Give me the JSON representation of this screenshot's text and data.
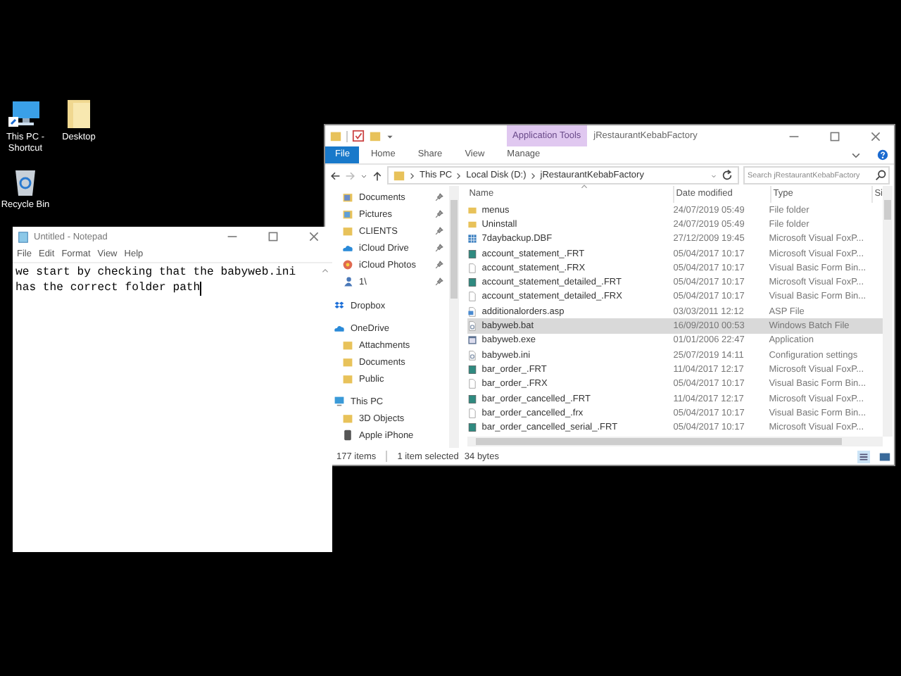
{
  "desktop_icons": [
    {
      "label": "This PC - Shortcut",
      "kind": "pc"
    },
    {
      "label": "Desktop",
      "kind": "folder"
    },
    {
      "label": "Recycle Bin",
      "kind": "bin"
    }
  ],
  "explorer": {
    "title": "jRestaurantKebabFactory",
    "context_label": "Application Tools",
    "tabs": [
      {
        "label": "File",
        "kind": "file"
      },
      {
        "label": "Home",
        "kind": "plain"
      },
      {
        "label": "Share",
        "kind": "plain"
      },
      {
        "label": "View",
        "kind": "plain"
      },
      {
        "label": "Manage",
        "kind": "plain"
      }
    ],
    "path": [
      "This PC",
      "Local Disk (D:)",
      "jRestaurantKebabFactory"
    ],
    "search": {
      "placeholder": "Search jRestaurantKebabFactory"
    },
    "nav": [
      {
        "label": "Documents",
        "kind": "doc",
        "pinned": true
      },
      {
        "label": "Pictures",
        "kind": "pic",
        "pinned": true
      },
      {
        "label": "CLIENTS",
        "kind": "folder",
        "pinned": true
      },
      {
        "label": "iCloud Drive",
        "kind": "cloud",
        "pinned": true
      },
      {
        "label": "iCloud Photos",
        "kind": "photos",
        "pinned": true
      },
      {
        "label": "1\\",
        "kind": "user",
        "pinned": true
      },
      {
        "label": "Dropbox",
        "kind": "dropbox",
        "pinned": false
      },
      {
        "label": "OneDrive",
        "kind": "cloud",
        "pinned": false
      },
      {
        "label": "Attachments",
        "kind": "folder",
        "pinned": false
      },
      {
        "label": "Documents",
        "kind": "folder",
        "pinned": false
      },
      {
        "label": "Public",
        "kind": "folder",
        "pinned": false
      },
      {
        "label": "This PC",
        "kind": "pc",
        "pinned": false
      },
      {
        "label": "3D Objects",
        "kind": "folder",
        "pinned": false
      },
      {
        "label": "Apple iPhone",
        "kind": "phone",
        "pinned": false
      }
    ],
    "columns": [
      "Name",
      "Date modified",
      "Type",
      "Si"
    ],
    "files": [
      {
        "name": "menus",
        "date": "24/07/2019 05:49",
        "type": "File folder",
        "kind": "folder",
        "selected": false
      },
      {
        "name": "Uninstall",
        "date": "24/07/2019 05:49",
        "type": "File folder",
        "kind": "folder",
        "selected": false
      },
      {
        "name": "7daybackup.DBF",
        "date": "27/12/2009 19:45",
        "type": "Microsoft Visual FoxP...",
        "kind": "table",
        "selected": false
      },
      {
        "name": "account_statement_.FRT",
        "date": "05/04/2017 10:17",
        "type": "Microsoft Visual FoxP...",
        "kind": "block",
        "selected": false
      },
      {
        "name": "account_statement_.FRX",
        "date": "05/04/2017 10:17",
        "type": "Visual Basic Form Bin...",
        "kind": "blank",
        "selected": false
      },
      {
        "name": "account_statement_detailed_.FRT",
        "date": "05/04/2017 10:17",
        "type": "Microsoft Visual FoxP...",
        "kind": "block",
        "selected": false
      },
      {
        "name": "account_statement_detailed_.FRX",
        "date": "05/04/2017 10:17",
        "type": "Visual Basic Form Bin...",
        "kind": "blank",
        "selected": false
      },
      {
        "name": "additionalorders.asp",
        "date": "03/03/2011 12:12",
        "type": "ASP File",
        "kind": "script",
        "selected": false
      },
      {
        "name": "babyweb.bat",
        "date": "16/09/2010 00:53",
        "type": "Windows Batch File",
        "kind": "gear",
        "selected": true
      },
      {
        "name": "babyweb.exe",
        "date": "01/01/2006 22:47",
        "type": "Application",
        "kind": "app",
        "selected": false
      },
      {
        "name": "babyweb.ini",
        "date": "25/07/2019 14:11",
        "type": "Configuration settings",
        "kind": "gear",
        "selected": false
      },
      {
        "name": "bar_order_.FRT",
        "date": "11/04/2017 12:17",
        "type": "Microsoft Visual FoxP...",
        "kind": "block",
        "selected": false
      },
      {
        "name": "bar_order_.FRX",
        "date": "05/04/2017 10:17",
        "type": "Visual Basic Form Bin...",
        "kind": "blank",
        "selected": false
      },
      {
        "name": "bar_order_cancelled_.FRT",
        "date": "11/04/2017 12:17",
        "type": "Microsoft Visual FoxP...",
        "kind": "block",
        "selected": false
      },
      {
        "name": "bar_order_cancelled_.frx",
        "date": "05/04/2017 10:17",
        "type": "Visual Basic Form Bin...",
        "kind": "blank",
        "selected": false
      },
      {
        "name": "bar_order_cancelled_serial_.FRT",
        "date": "05/04/2017 10:17",
        "type": "Microsoft Visual FoxP...",
        "kind": "block",
        "selected": false
      }
    ],
    "status": {
      "count": "177 items",
      "selection": "1 item selected",
      "size": "34 bytes"
    }
  },
  "notepad": {
    "title": "Untitled - Notepad",
    "menus": [
      "File",
      "Edit",
      "Format",
      "View",
      "Help"
    ],
    "lines": [
      "we start by checking that the babyweb.ini",
      "has the correct folder path"
    ]
  }
}
